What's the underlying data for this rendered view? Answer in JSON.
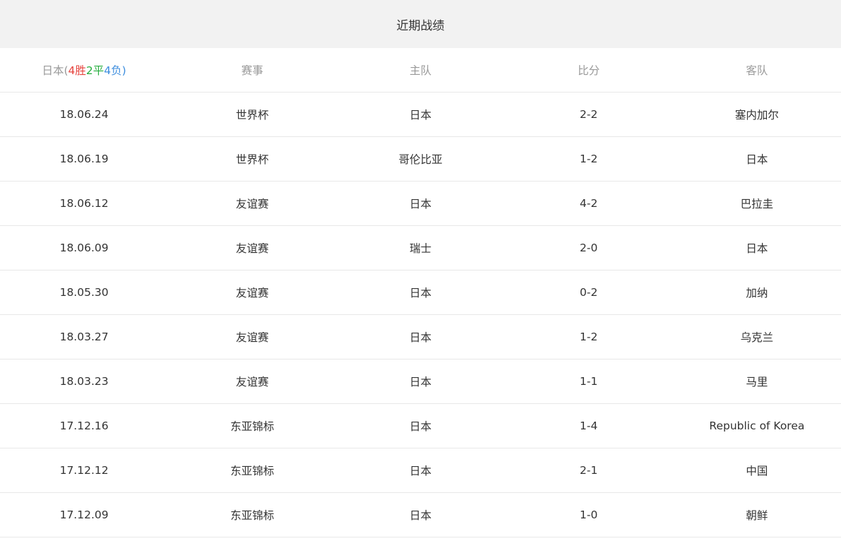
{
  "title": "近期战绩",
  "header": {
    "team_label": "日本(",
    "wins": "4胜",
    "draws": "2平",
    "losses": "4负",
    "close": ")",
    "competition": "赛事",
    "home": "主队",
    "score": "比分",
    "away": "客队"
  },
  "colors": {
    "win": "#e6453f",
    "draw": "#27ae3f",
    "loss": "#3e8ede",
    "text": "#333333",
    "header_text": "#999999"
  },
  "matches": [
    {
      "date": "18.06.24",
      "competition": "世界杯",
      "home": "日本",
      "score": "2-2",
      "away": "塞内加尔",
      "result": "draw",
      "japan_side": "home"
    },
    {
      "date": "18.06.19",
      "competition": "世界杯",
      "home": "哥伦比亚",
      "score": "1-2",
      "away": "日本",
      "result": "win",
      "japan_side": "away"
    },
    {
      "date": "18.06.12",
      "competition": "友谊赛",
      "home": "日本",
      "score": "4-2",
      "away": "巴拉圭",
      "result": "win",
      "japan_side": "home"
    },
    {
      "date": "18.06.09",
      "competition": "友谊赛",
      "home": "瑞士",
      "score": "2-0",
      "away": "日本",
      "result": "loss",
      "japan_side": "away"
    },
    {
      "date": "18.05.30",
      "competition": "友谊赛",
      "home": "日本",
      "score": "0-2",
      "away": "加纳",
      "result": "loss",
      "japan_side": "home"
    },
    {
      "date": "18.03.27",
      "competition": "友谊赛",
      "home": "日本",
      "score": "1-2",
      "away": "乌克兰",
      "result": "loss",
      "japan_side": "home"
    },
    {
      "date": "18.03.23",
      "competition": "友谊赛",
      "home": "日本",
      "score": "1-1",
      "away": "马里",
      "result": "draw",
      "japan_side": "home"
    },
    {
      "date": "17.12.16",
      "competition": "东亚锦标",
      "home": "日本",
      "score": "1-4",
      "away": "Republic of Korea",
      "result": "loss",
      "japan_side": "home"
    },
    {
      "date": "17.12.12",
      "competition": "东亚锦标",
      "home": "日本",
      "score": "2-1",
      "away": "中国",
      "result": "win",
      "japan_side": "home"
    },
    {
      "date": "17.12.09",
      "competition": "东亚锦标",
      "home": "日本",
      "score": "1-0",
      "away": "朝鲜",
      "result": "win",
      "japan_side": "home"
    }
  ]
}
